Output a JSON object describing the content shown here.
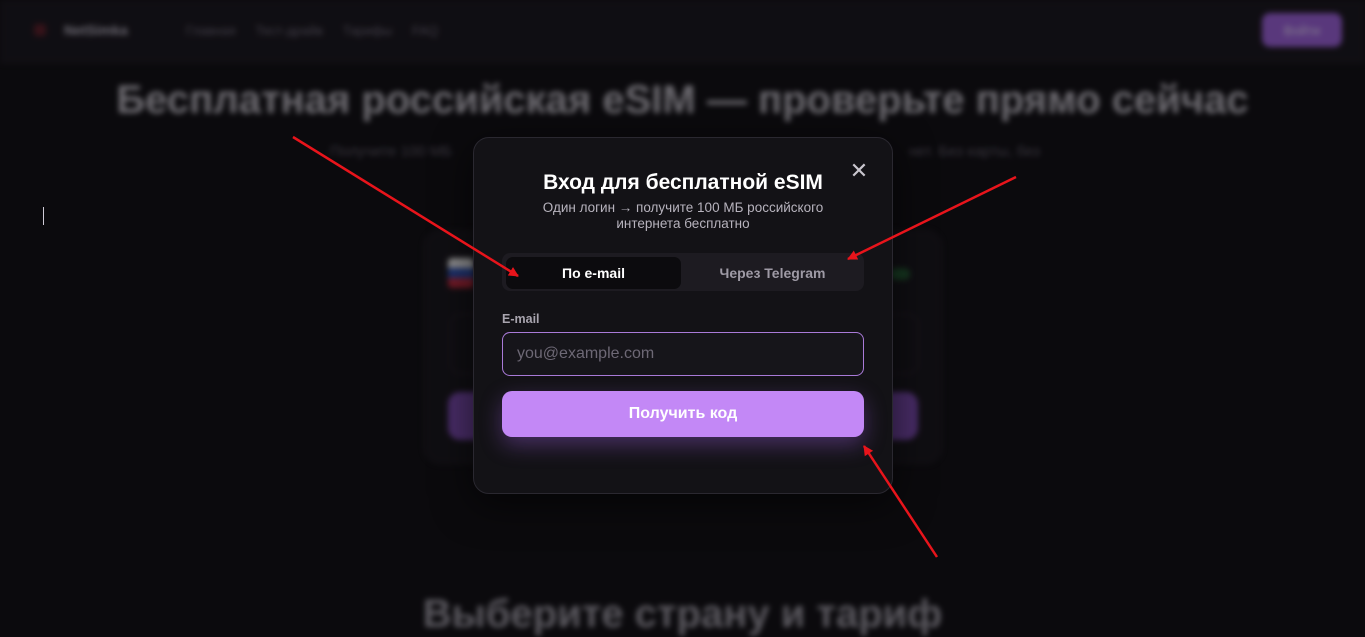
{
  "background": {
    "brand": "NetSimka",
    "nav": [
      "Главная",
      "Тест-драйв",
      "Тарифы",
      "FAQ"
    ],
    "login_button": "Войти",
    "hero_title": "Бесплатная российская eSIM — проверьте прямо сейчас",
    "hero_subtitle_left": "Получите 100 МБ",
    "hero_subtitle_right": "нет. Без карты, без",
    "section_title": "Выберите страну и тариф"
  },
  "modal": {
    "close_icon": "close-icon",
    "title": "Вход для бесплатной eSIM",
    "subtitle": "Один логин → получите 100 МБ российского интернета бесплатно",
    "tabs": [
      {
        "label": "По e-mail",
        "active": true
      },
      {
        "label": "Через Telegram",
        "active": false
      }
    ],
    "email_label": "E-mail",
    "email_placeholder": "you@example.com",
    "email_value": "",
    "submit_label": "Получить код"
  },
  "colors": {
    "accent": "#c388f6",
    "input_border": "#a97ad8",
    "annotation_arrow": "#e8141b",
    "modal_bg": "#131216"
  }
}
